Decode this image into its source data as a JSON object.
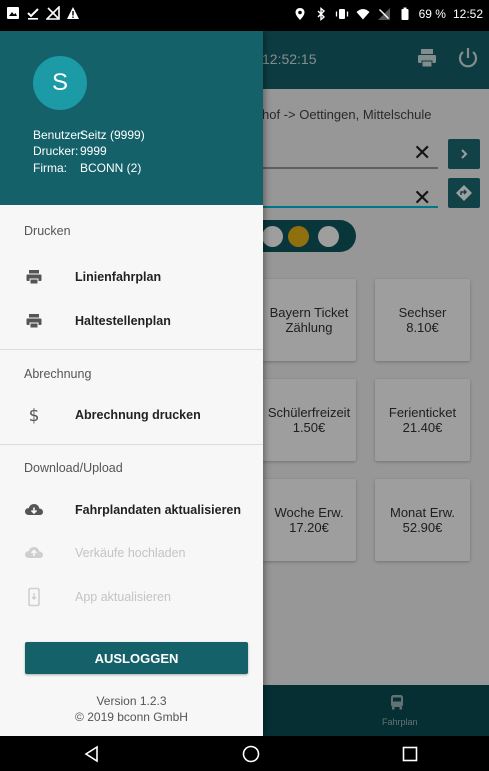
{
  "status_bar": {
    "battery": "69 %",
    "time": "12:52"
  },
  "app": {
    "time": "12:52:15",
    "route": "hof -> Oettingen, Mittelschule",
    "tiles": [
      {
        "name": "Bayern Ticket",
        "value": "Zählung"
      },
      {
        "name": "Sechser",
        "value": "8.10€"
      },
      {
        "name": "Schülerfreizeit",
        "value": "1.50€"
      },
      {
        "name": "Ferienticket",
        "value": "21.40€"
      },
      {
        "name": "Woche Erw.",
        "value": "17.20€"
      },
      {
        "name": "Monat Erw.",
        "value": "52.90€"
      }
    ],
    "bottom_nav_label": "Fahrplan"
  },
  "drawer": {
    "avatar_letter": "S",
    "info": [
      {
        "key": "Benutzer:",
        "value": "Seitz (9999)"
      },
      {
        "key": "Drucker:",
        "value": "9999"
      },
      {
        "key": "Firma:",
        "value": "BCONN (2)"
      }
    ],
    "sections": [
      {
        "label": "Drucken"
      },
      {
        "label": "Abrechnung"
      },
      {
        "label": "Download/Upload"
      }
    ],
    "items": [
      {
        "label": "Linienfahrplan",
        "icon": "printer-icon"
      },
      {
        "label": "Haltestellenplan",
        "icon": "printer-icon"
      },
      {
        "label": "Abrechnung drucken",
        "icon": "dollar-icon"
      },
      {
        "label": "Fahrplandaten aktualisieren",
        "icon": "cloud-download-icon"
      },
      {
        "label": "Verkäufe hochladen",
        "icon": "cloud-upload-icon"
      },
      {
        "label": "App aktualisieren",
        "icon": "phone-update-icon"
      }
    ],
    "logout_label": "AUSLOGGEN",
    "version_line": "Version 1.2.3",
    "copyright_line": "© 2019 bconn GmbH"
  },
  "colors": {
    "primary": "#14616a",
    "avatar": "#1c9aa5",
    "accent_line": "#00c0d6",
    "light_yellow": "#e7b417"
  }
}
